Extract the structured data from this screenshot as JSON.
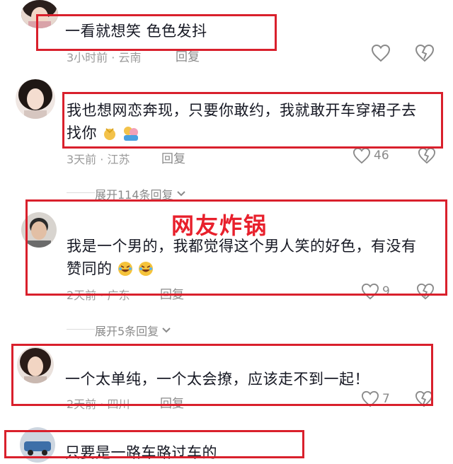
{
  "comments": [
    {
      "username": "",
      "text": "一看就想笑 色色发抖",
      "meta": "3小时前 · 云南",
      "reply": "回复",
      "likes": ""
    },
    {
      "username": "",
      "text_line1": "我也想网恋奔现，只要你敢约，我就敢开车穿裙子去",
      "text_line2": "找你",
      "emojis": [
        "kiss-mark-emoji",
        "couple-emoji"
      ],
      "meta": "3天前 · 江苏",
      "reply": "回复",
      "likes": "46"
    },
    {
      "username": "",
      "text_line1": "我是一个男的，我都觉得这个男人笑的好色，有没有",
      "text_line2": "赞同的",
      "emojis": [
        "laughing-emoji",
        "laughing-emoji"
      ],
      "meta": "2天前 · 广东",
      "reply": "回复",
      "likes": "9"
    },
    {
      "username": "",
      "text": "一个太单纯，一个太会撩，应该走不到一起！",
      "meta": "2天前 · 四川",
      "reply": "回复",
      "likes": "7"
    },
    {
      "text": "只要是一路车路过车的"
    }
  ],
  "expand_replies": [
    {
      "label": "展开114条回复"
    },
    {
      "label": "展开5条回复"
    }
  ],
  "overlay_caption": "网友炸锅",
  "colors": {
    "highlight_red": "#d9202c",
    "caption_red": "#e8202c",
    "meta_gray": "#9b9b9b"
  },
  "icons": [
    "heart-outline-icon",
    "broken-heart-icon",
    "chevron-down-icon"
  ]
}
